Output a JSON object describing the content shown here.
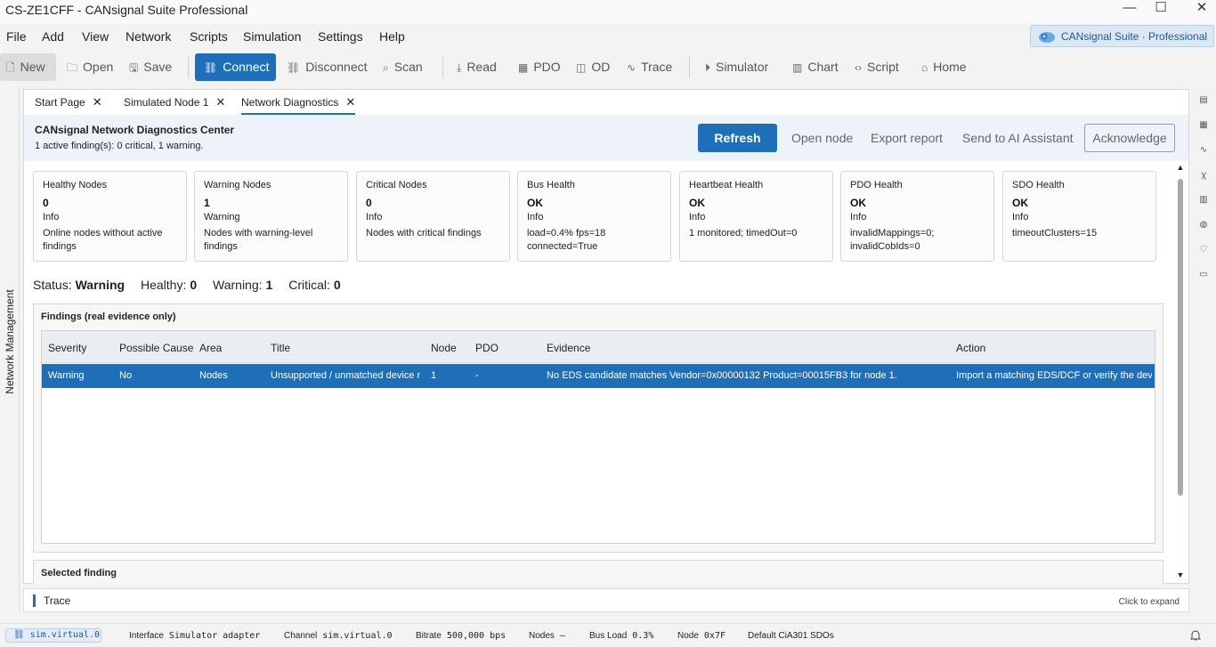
{
  "window": {
    "title": "CS-ZE1CFF - CANsignal Suite Professional",
    "minimize_glyph": "—",
    "maximize_glyph": "☐",
    "close_glyph": "✕"
  },
  "menu": [
    "File",
    "Add",
    "View",
    "Network",
    "Scripts",
    "Simulation",
    "Settings",
    "Help"
  ],
  "brand": {
    "label": "CANsignal Suite · Professional",
    "icon": "cloud-gear-icon"
  },
  "toolbar": {
    "new": "New",
    "open": "Open",
    "save": "Save",
    "connect": "Connect",
    "disconnect": "Disconnect",
    "scan": "Scan",
    "read": "Read",
    "pdo": "PDO",
    "od": "OD",
    "trace": "Trace",
    "simulator": "Simulator",
    "chart": "Chart",
    "script": "Script",
    "home": "Home"
  },
  "left_panel": {
    "label": "Network Management"
  },
  "tabs": [
    {
      "label": "Start Page",
      "close": "✕"
    },
    {
      "label": "Simulated Node 1",
      "close": "✕"
    },
    {
      "label": "Network Diagnostics",
      "close": "✕",
      "active": true
    }
  ],
  "diagnostics": {
    "title": "CANsignal Network Diagnostics Center",
    "subtitle": "1 active finding(s): 0 critical, 1 warning.",
    "actions": {
      "refresh": "Refresh",
      "open_node": "Open node",
      "export_report": "Export report",
      "send_ai": "Send to AI Assistant",
      "acknowledge": "Acknowledge"
    },
    "cards": [
      {
        "name": "Healthy Nodes",
        "value": "0",
        "level": "Info",
        "desc": "Online nodes without active findings"
      },
      {
        "name": "Warning Nodes",
        "value": "1",
        "level": "Warning",
        "desc": "Nodes with warning-level findings"
      },
      {
        "name": "Critical Nodes",
        "value": "0",
        "level": "Info",
        "desc": "Nodes with critical findings"
      },
      {
        "name": "Bus Health",
        "value": "OK",
        "level": "Info",
        "desc": "load≈0.4% fps=18 connected=True"
      },
      {
        "name": "Heartbeat Health",
        "value": "OK",
        "level": "Info",
        "desc": "1 monitored; timedOut=0"
      },
      {
        "name": "PDO Health",
        "value": "OK",
        "level": "Info",
        "desc": "invalidMappings=0; invalidCobIds=0"
      },
      {
        "name": "SDO Health",
        "value": "OK",
        "level": "Info",
        "desc": "timeoutClusters=15"
      }
    ],
    "status": {
      "status_label": "Status:",
      "status_value": "Warning",
      "healthy_label": "Healthy:",
      "healthy_value": "0",
      "warning_label": "Warning:",
      "warning_value": "1",
      "critical_label": "Critical:",
      "critical_value": "0"
    },
    "findings": {
      "title": "Findings (real evidence only)",
      "columns": [
        "Severity",
        "Possible Cause",
        "Area",
        "Title",
        "Node",
        "PDO",
        "Evidence",
        "Action"
      ],
      "rows": [
        [
          "Warning",
          "No",
          "Nodes",
          "Unsupported / unmatched device model",
          "1",
          "-",
          "No EDS candidate matches Vendor=0x00000132 Product=00015FB3 for node 1.",
          "Import a matching EDS/DCF or verify the device identity"
        ]
      ]
    },
    "selected_finding": {
      "title": "Selected finding"
    }
  },
  "trace": {
    "title": "Trace",
    "hint": "Click to expand"
  },
  "statusbar": {
    "chip": "sim.virtual.0",
    "interface_label": "Interface",
    "interface_value": "Simulator adapter",
    "channel_label": "Channel",
    "channel_value": "sim.virtual.0",
    "bitrate_label": "Bitrate",
    "bitrate_value": "500,000 bps",
    "nodes_label": "Nodes",
    "nodes_value": "–",
    "busload_label": "Bus Load",
    "busload_value": "0.3%",
    "node_label": "Node",
    "node_value": "0x7F",
    "sdo_label": "Default CiA301 SDOs"
  },
  "colors": {
    "accent": "#1e6fb8",
    "header_band": "#eef3f9",
    "grid_header": "#e9eef5"
  }
}
